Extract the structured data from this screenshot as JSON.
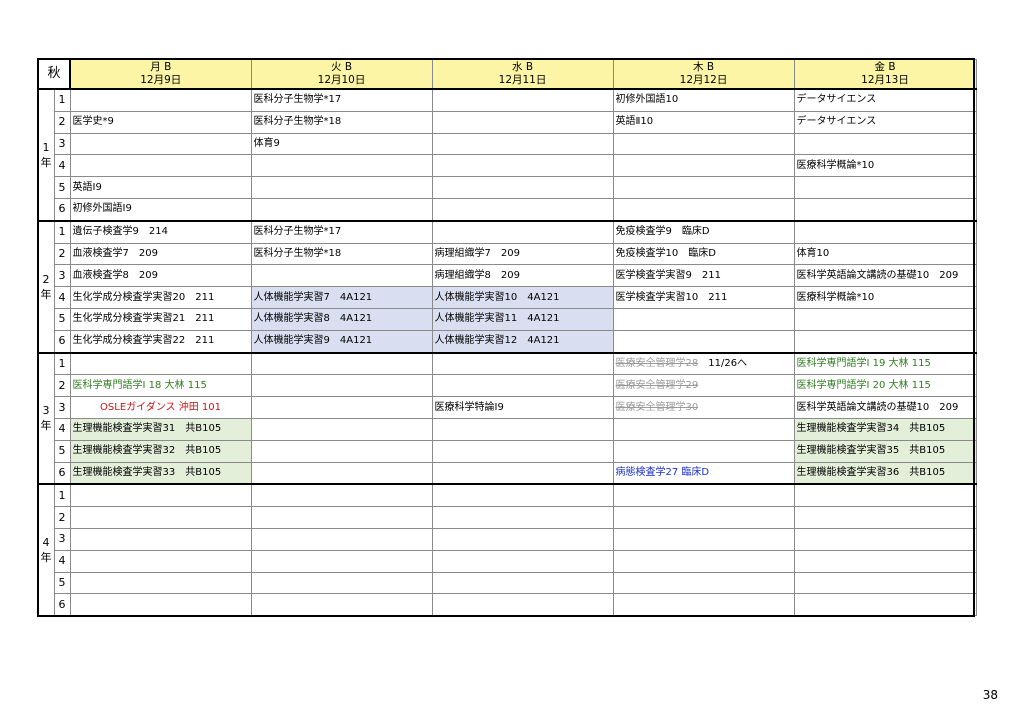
{
  "term": "秋",
  "days": [
    {
      "name": "月 B",
      "date": "12月9日"
    },
    {
      "name": "火 B",
      "date": "12月10日"
    },
    {
      "name": "水 B",
      "date": "12月11日"
    },
    {
      "name": "木 B",
      "date": "12月12日"
    },
    {
      "name": "金 B",
      "date": "12月13日"
    }
  ],
  "years": [
    {
      "label_num": "1",
      "label_suffix": "年",
      "periods": [
        {
          "p": "1",
          "cells": [
            "",
            "医科分子生物学*17",
            "",
            "初修外国語10",
            "データサイエンス"
          ]
        },
        {
          "p": "2",
          "cells": [
            "医学史*9",
            "医科分子生物学*18",
            "",
            "英語Ⅱ10",
            "データサイエンス"
          ]
        },
        {
          "p": "3",
          "cells": [
            "",
            "体育9",
            "",
            "",
            ""
          ]
        },
        {
          "p": "4",
          "cells": [
            "",
            "",
            "",
            "",
            "医療科学概論*10"
          ]
        },
        {
          "p": "5",
          "cells": [
            "英語Ⅰ9",
            "",
            "",
            "",
            ""
          ]
        },
        {
          "p": "6",
          "cells": [
            "初修外国語Ⅰ9",
            "",
            "",
            "",
            ""
          ]
        }
      ]
    },
    {
      "label_num": "2",
      "label_suffix": "年",
      "periods": [
        {
          "p": "1",
          "cells": [
            "遺伝子検査学9　214",
            "医科分子生物学*17",
            "",
            "免疫検査学9　臨床D",
            ""
          ]
        },
        {
          "p": "2",
          "cells": [
            "血液検査学7　209",
            "医科分子生物学*18",
            "病理組織学7　209",
            "免疫検査学10　臨床D",
            "体育10"
          ]
        },
        {
          "p": "3",
          "cells": [
            "血液検査学8　209",
            "",
            "病理組織学8　209",
            "医学検査学実習9　211",
            "医科学英語論文講読の基礎10　209"
          ]
        },
        {
          "p": "4",
          "cells": [
            "生化学成分検査学実習20　211",
            "人体機能学実習7　4A121",
            "人体機能学実習10　4A121",
            "医学検査学実習10　211",
            "医療科学概論*10"
          ]
        },
        {
          "p": "5",
          "cells": [
            "生化学成分検査学実習21　211",
            "人体機能学実習8　4A121",
            "人体機能学実習11　4A121",
            "",
            ""
          ]
        },
        {
          "p": "6",
          "cells": [
            "生化学成分検査学実習22　211",
            "人体機能学実習9　4A121",
            "人体機能学実習12　4A121",
            "",
            ""
          ]
        }
      ]
    },
    {
      "label_num": "3",
      "label_suffix": "年",
      "periods": [
        {
          "p": "1",
          "cells": [
            "",
            "",
            "",
            "",
            "医科学専門語学Ⅰ 19 大林 115"
          ],
          "thu_strike": "医療安全管理学28",
          "thu_rest": "　11/26へ"
        },
        {
          "p": "2",
          "cells": [
            "医科学専門語学Ⅰ 18 大林 115",
            "",
            "",
            "",
            "医科学専門語学Ⅰ 20 大林 115"
          ],
          "thu_strike": "医療安全管理学29",
          "thu_rest": ""
        },
        {
          "p": "3",
          "cells": [
            "OSLEガイダンス 沖田 101",
            "",
            "医療科学特論Ⅰ9",
            "",
            "医科学英語論文講読の基礎10　209"
          ],
          "thu_strike": "医療安全管理学30",
          "thu_rest": ""
        },
        {
          "p": "4",
          "cells": [
            "生理機能検査学実習31　共B105",
            "",
            "",
            "",
            "生理機能検査学実習34　共B105"
          ]
        },
        {
          "p": "5",
          "cells": [
            "生理機能検査学実習32　共B105",
            "",
            "",
            "",
            "生理機能検査学実習35　共B105"
          ]
        },
        {
          "p": "6",
          "cells": [
            "生理機能検査学実習33　共B105",
            "",
            "",
            "病態検査学27 臨床D",
            "生理機能検査学実習36　共B105"
          ]
        }
      ]
    },
    {
      "label_num": "4",
      "label_suffix": "年",
      "periods": [
        {
          "p": "1",
          "cells": [
            "",
            "",
            "",
            "",
            ""
          ]
        },
        {
          "p": "2",
          "cells": [
            "",
            "",
            "",
            "",
            ""
          ]
        },
        {
          "p": "3",
          "cells": [
            "",
            "",
            "",
            "",
            ""
          ]
        },
        {
          "p": "4",
          "cells": [
            "",
            "",
            "",
            "",
            ""
          ]
        },
        {
          "p": "5",
          "cells": [
            "",
            "",
            "",
            "",
            ""
          ]
        },
        {
          "p": "6",
          "cells": [
            "",
            "",
            "",
            "",
            ""
          ]
        }
      ]
    }
  ],
  "colors": {
    "header_yellow": "#fcf5a6",
    "blue_cell": "#d9dff0",
    "green_cell": "#e4efda",
    "green_text": "#2e7d1f",
    "red_text": "#cc1111",
    "blue_text": "#1a2fd0"
  },
  "page_number": "38"
}
